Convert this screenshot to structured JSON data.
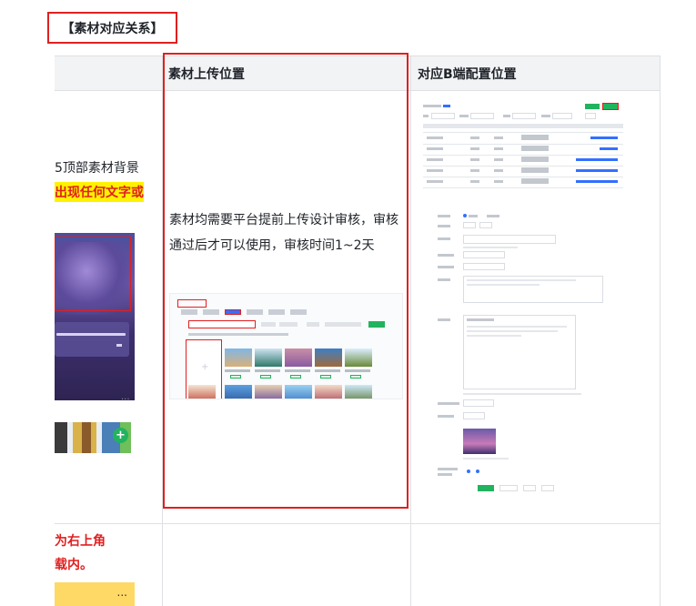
{
  "section_title": "【素材对应关系】",
  "table": {
    "headers": [
      "素材上传位置",
      "对应B端配置位置"
    ],
    "left_clip": {
      "text_line1": "5顶部素材背景",
      "text_line2": "出现任何文字或",
      "row2_line1": "为右上角",
      "row2_line2": "载内。",
      "ellipsis": "...",
      "small_ellipsis": "···",
      "plus": "+"
    },
    "middle": {
      "description": "素材均需要平台提前上传设计审核，审核通过后才可以使用，审核时间1~2天"
    }
  },
  "colors": {
    "highlight_red": "#e02020",
    "highlight_yellow": "#fff200",
    "brand_green": "#22b35e",
    "header_bg": "#f2f3f5",
    "border": "#dee0e3"
  }
}
